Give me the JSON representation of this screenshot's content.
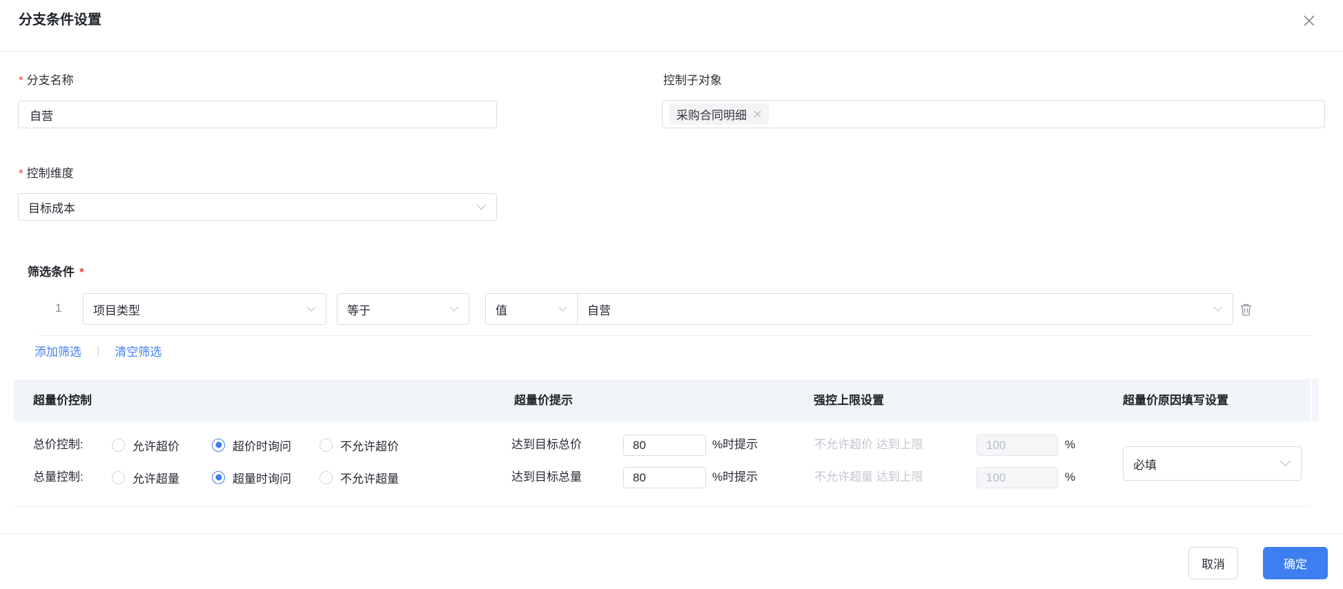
{
  "dialog": {
    "title": "分支条件设置"
  },
  "marks": {
    "required": "*"
  },
  "fields": {
    "branch_name": {
      "label": "分支名称",
      "value": "自营"
    },
    "control_sub_object": {
      "label": "控制子对象",
      "tag": "采购合同明细"
    },
    "control_dimension": {
      "label": "控制维度",
      "value": "目标成本"
    }
  },
  "filter": {
    "label": "筛选条件",
    "rows": [
      {
        "index": "1",
        "field": "项目类型",
        "operator": "等于",
        "value_type": "值",
        "value": "自营"
      }
    ],
    "add_link": "添加筛选",
    "separator": "|",
    "clear_link": "清空筛选"
  },
  "table": {
    "headers": [
      "超量价控制",
      "超量价提示",
      "强控上限设置",
      "超量价原因填写设置"
    ],
    "rows": [
      {
        "label": "总价控制:",
        "radios": [
          {
            "label": "允许超价",
            "checked": false
          },
          {
            "label": "超价时询问",
            "checked": true
          },
          {
            "label": "不允许超价",
            "checked": false
          }
        ],
        "hint_prefix": "达到目标总价",
        "hint_value": "80",
        "hint_suffix": "%时提示",
        "limit_text": "不允许超价 达到上限",
        "limit_value": "100",
        "limit_suffix": "%"
      },
      {
        "label": "总量控制:",
        "radios": [
          {
            "label": "允许超量",
            "checked": false
          },
          {
            "label": "超量时询问",
            "checked": true
          },
          {
            "label": "不允许超量",
            "checked": false
          }
        ],
        "hint_prefix": "达到目标总量",
        "hint_value": "80",
        "hint_suffix": "%时提示",
        "limit_text": "不允许超量 达到上限",
        "limit_value": "100",
        "limit_suffix": "%"
      }
    ],
    "reason_select_value": "必填"
  },
  "footer": {
    "cancel": "取消",
    "confirm": "确定"
  },
  "colors": {
    "accent": "#3d7ff0",
    "danger": "#f04134",
    "header_bg": "#f1f4f9",
    "divider": "#e9ecf0",
    "disabled_text": "#c3c7cf"
  }
}
